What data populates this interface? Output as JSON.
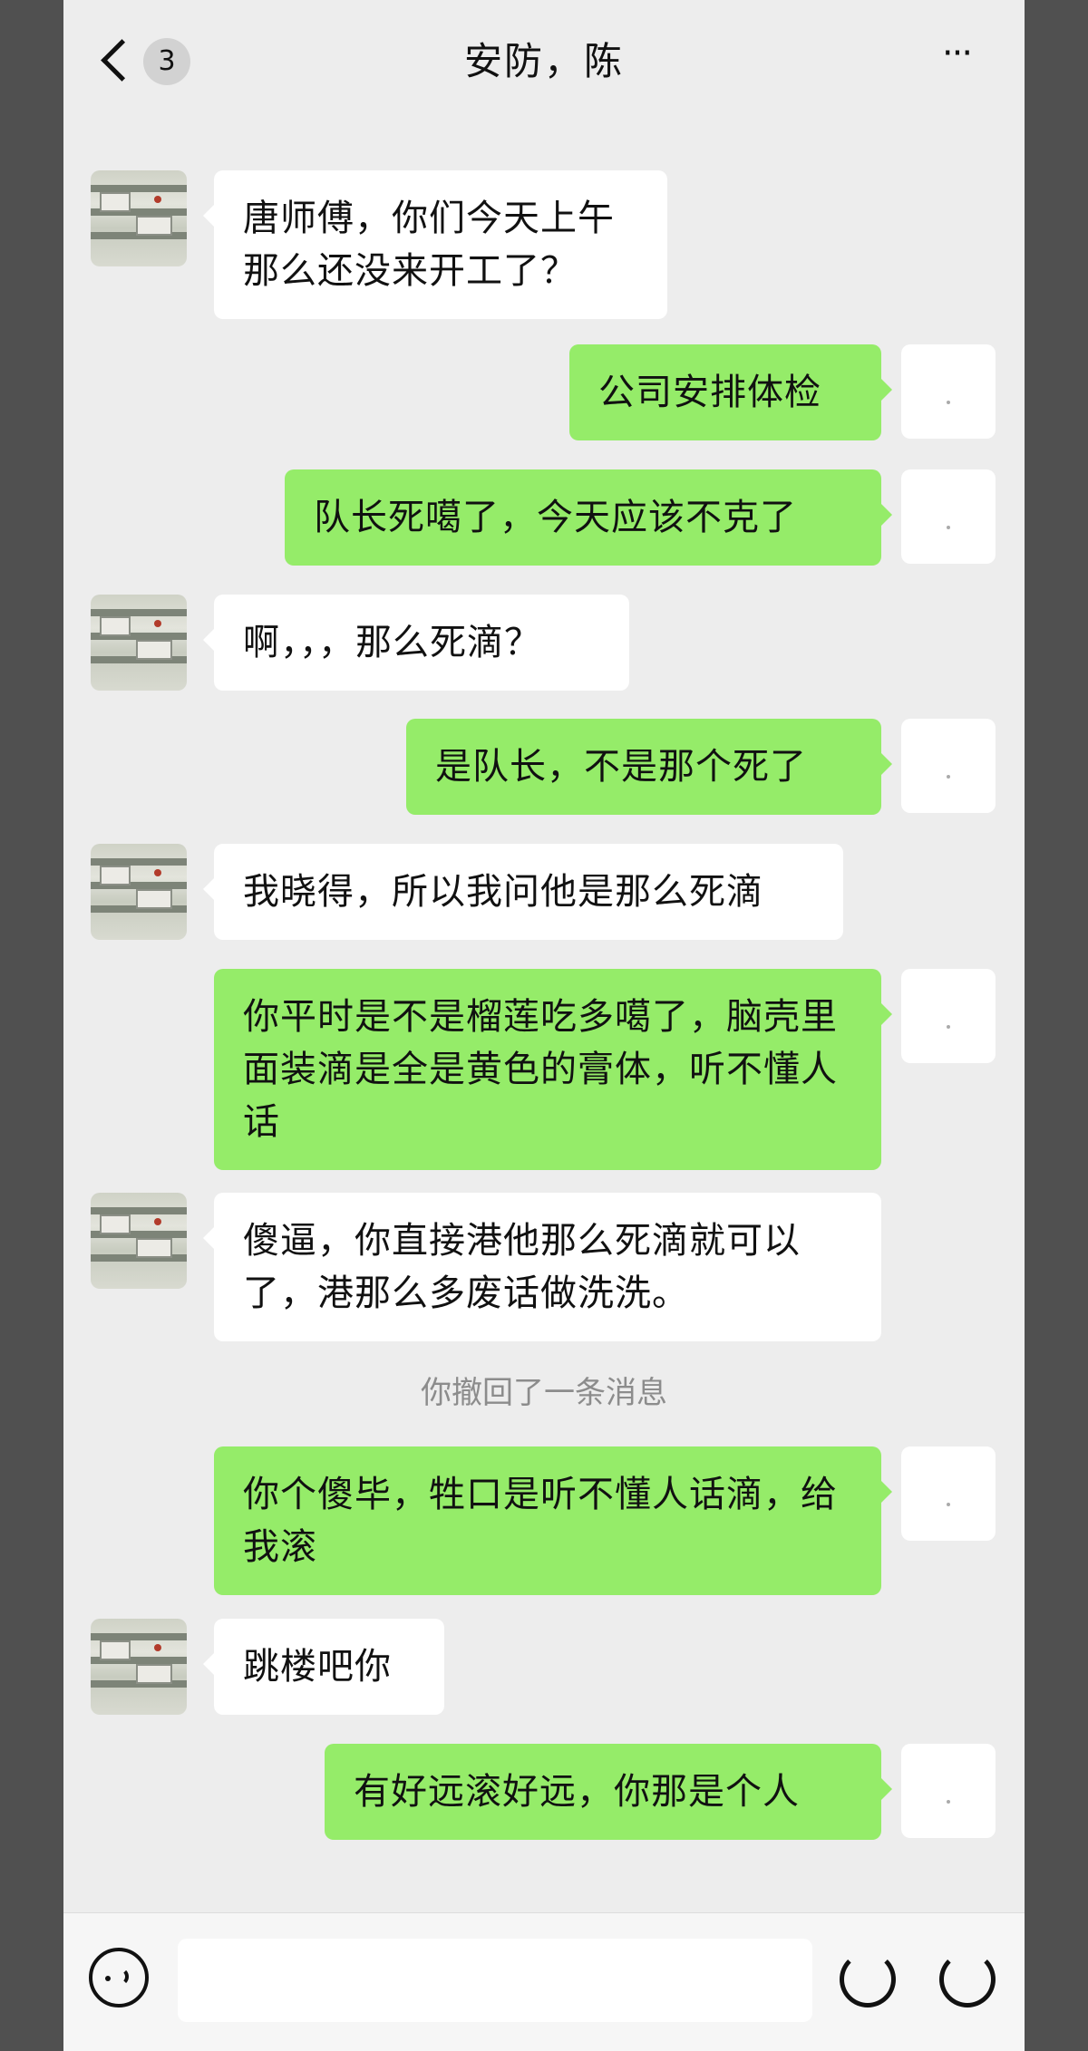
{
  "header": {
    "back_count": "3",
    "title": "安防，陈",
    "more": "···"
  },
  "messages": [
    {
      "side": "left",
      "text": "唐师傅，你们今天上午那么还没来开工了？"
    },
    {
      "side": "right",
      "text": "公司安排体检"
    },
    {
      "side": "right",
      "text": "队长死噶了，今天应该不克了"
    },
    {
      "side": "left",
      "text": "啊，，，那么死滴？"
    },
    {
      "side": "right",
      "text": "是队长，不是那个死了"
    },
    {
      "side": "left",
      "text": "我晓得，所以我问他是那么死滴"
    },
    {
      "side": "right",
      "text": "你平时是不是榴莲吃多噶了，脑壳里面装滴是全是黄色的膏体，听不懂人话"
    },
    {
      "side": "left",
      "text": "傻逼，你直接港他那么死滴就可以了，港那么多废话做洗洗。"
    },
    {
      "side": "right",
      "text": "你个傻毕，牲口是听不懂人话滴，给我滚"
    },
    {
      "side": "left",
      "text": "跳楼吧你"
    },
    {
      "side": "right",
      "text": "有好远滚好远，你那是个人"
    }
  ],
  "system_note": "你撤回了一条消息",
  "colors": {
    "outgoing_bubble": "#95ec69",
    "incoming_bubble": "#ffffff",
    "chat_background": "#ededed"
  },
  "icons": {
    "back": "chevron-left-icon",
    "more": "more-dots-icon",
    "voice": "voice-icon",
    "emoji": "emoji-icon",
    "plus": "plus-icon"
  }
}
